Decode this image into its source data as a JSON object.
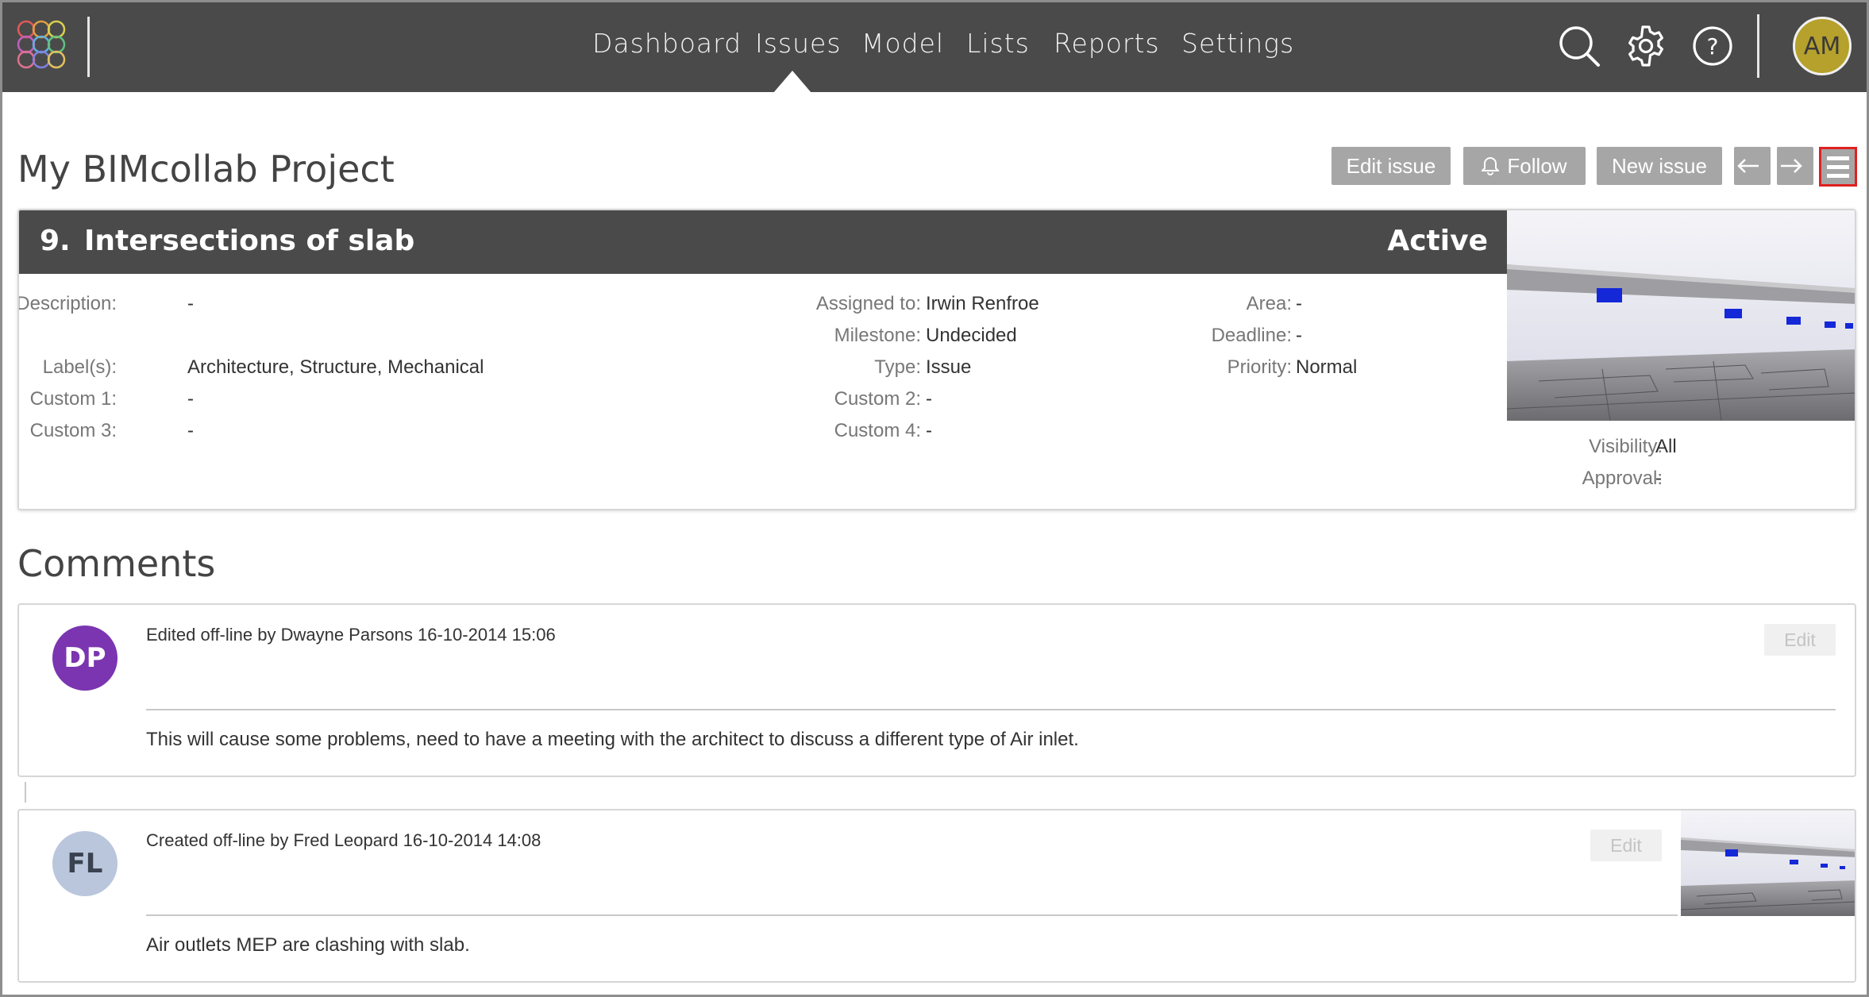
{
  "nav": {
    "items": [
      "Dashboard",
      "Issues",
      "Model",
      "Lists",
      "Reports",
      "Settings"
    ],
    "active": "Issues"
  },
  "user": {
    "initials": "AM"
  },
  "icons": {
    "logo": "bimcollab-logo",
    "search": "search-icon",
    "settings": "gear-icon",
    "help": "help-icon"
  },
  "page": {
    "title": "My BIMcollab Project"
  },
  "toolbar": {
    "edit_label": "Edit issue",
    "follow_label": "Follow",
    "new_label": "New issue"
  },
  "issue": {
    "number": "9.",
    "title": "Intersections of slab",
    "status": "Active",
    "fields": {
      "description": {
        "label": "Description:",
        "value": "-"
      },
      "labels": {
        "label": "Label(s):",
        "value": "Architecture, Structure, Mechanical"
      },
      "custom1": {
        "label": "Custom 1:",
        "value": "-"
      },
      "custom3": {
        "label": "Custom 3:",
        "value": "-"
      },
      "assigned": {
        "label": "Assigned to:",
        "value": "Irwin Renfroe"
      },
      "milestone": {
        "label": "Milestone:",
        "value": "Undecided"
      },
      "type": {
        "label": "Type:",
        "value": "Issue"
      },
      "custom2": {
        "label": "Custom 2:",
        "value": "-"
      },
      "custom4": {
        "label": "Custom 4:",
        "value": "-"
      },
      "area": {
        "label": "Area:",
        "value": "-"
      },
      "deadline": {
        "label": "Deadline:",
        "value": "-"
      },
      "priority": {
        "label": "Priority:",
        "value": "Normal"
      },
      "visibility": {
        "label": "Visibility:",
        "value": "All"
      },
      "approval": {
        "label": "Approval:",
        "value": "-"
      }
    }
  },
  "comments": {
    "title": "Comments",
    "items": [
      {
        "initials": "DP",
        "avatar_color": "#7b35b0",
        "meta": "Edited off-line by Dwayne Parsons 16-10-2014 15:06",
        "text": "This will cause some problems, need to have a meeting with the architect to discuss a different type of Air inlet.",
        "edit_label": "Edit"
      },
      {
        "initials": "FL",
        "avatar_color": "#b9c6dc",
        "meta": "Created off-line by Fred Leopard 16-10-2014 14:08",
        "text": "Air outlets MEP are clashing with slab.",
        "edit_label": "Edit"
      }
    ]
  }
}
